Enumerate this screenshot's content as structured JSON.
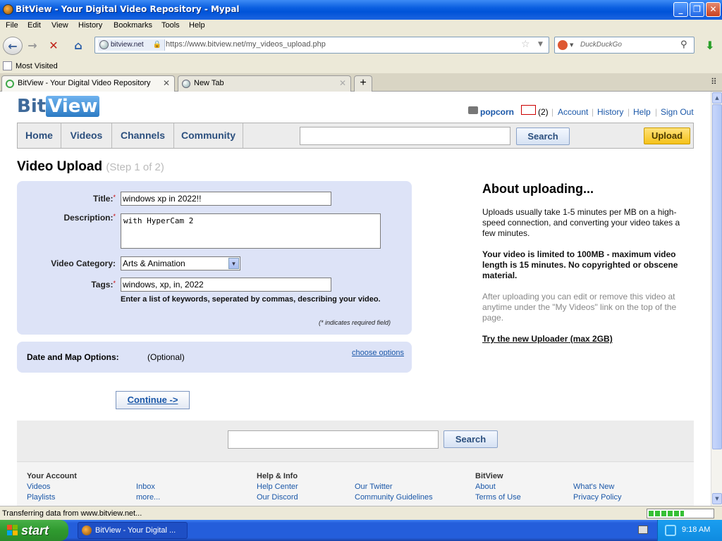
{
  "window": {
    "title": "BitView - Your Digital Video Repository - Mypal"
  },
  "menu": [
    "File",
    "Edit",
    "View",
    "History",
    "Bookmarks",
    "Tools",
    "Help"
  ],
  "address": {
    "site_badge": "bitview.net",
    "url": "https://www.bitview.net/my_videos_upload.php"
  },
  "search_engine": {
    "placeholder": "DuckDuckGo"
  },
  "bookmarks": {
    "most_visited": "Most Visited"
  },
  "tabs": [
    {
      "label": "BitView - Your Digital Video Repository",
      "active": true
    },
    {
      "label": "New Tab",
      "active": false
    }
  ],
  "site": {
    "logo_bit": "Bit",
    "logo_view": "View",
    "user": "popcorn",
    "inbox_count": "(2)",
    "top_links": [
      "Account",
      "History",
      "Help",
      "Sign Out"
    ],
    "nav": [
      "Home",
      "Videos",
      "Channels",
      "Community"
    ],
    "search_label": "Search",
    "upload_label": "Upload"
  },
  "page": {
    "title": "Video Upload",
    "step": "(Step 1 of 2)"
  },
  "form": {
    "title_label": "Title:",
    "title_value": "windows xp in 2022!!",
    "description_label": "Description:",
    "description_value": "with HyperCam 2",
    "category_label": "Video Category:",
    "category_value": "Arts & Animation",
    "tags_label": "Tags:",
    "tags_value": "windows, xp, in, 2022",
    "tags_hint": "Enter a list of keywords, seperated by commas, describing your video.",
    "required_note": "(* indicates required field)",
    "required_mark": "*"
  },
  "date_map": {
    "label": "Date and Map Options:",
    "optional": "(Optional)",
    "choose": "choose options"
  },
  "continue_label": "Continue ->",
  "about": {
    "title": "About uploading...",
    "p1": "Uploads usually take 1-5 minutes per MB on a high-speed connection, and converting your video takes a few minutes.",
    "p2": "Your video is limited to 100MB - maximum video length is 15 minutes. No copyrighted or obscene material.",
    "p3": "After uploading you can edit or remove this video at anytime under the \"My Videos\" link on the top of the page.",
    "link": "Try the new Uploader (max 2GB)"
  },
  "footer": {
    "search_label": "Search",
    "col1_title": "Your Account",
    "col1_links": [
      "Videos",
      "Inbox",
      "Playlists",
      "more..."
    ],
    "col2_title": "Help & Info",
    "col2_links": [
      "Help Center",
      "Our Twitter",
      "Our Discord",
      "Community Guidelines"
    ],
    "col3_title": "BitView",
    "col3_links": [
      "About",
      "What's New",
      "Terms of Use",
      "Privacy Policy"
    ]
  },
  "status": {
    "text": "Transferring data from www.bitview.net...",
    "progress": 0.55
  },
  "taskbar": {
    "start": "start",
    "item": "BitView - Your Digital ...",
    "time": "9:18 AM"
  },
  "colors": {
    "nav_text": "#2b4f7e",
    "link": "#1a57a8",
    "form_bg": "#dde3f7",
    "upload_btn": "#f5c21a"
  }
}
